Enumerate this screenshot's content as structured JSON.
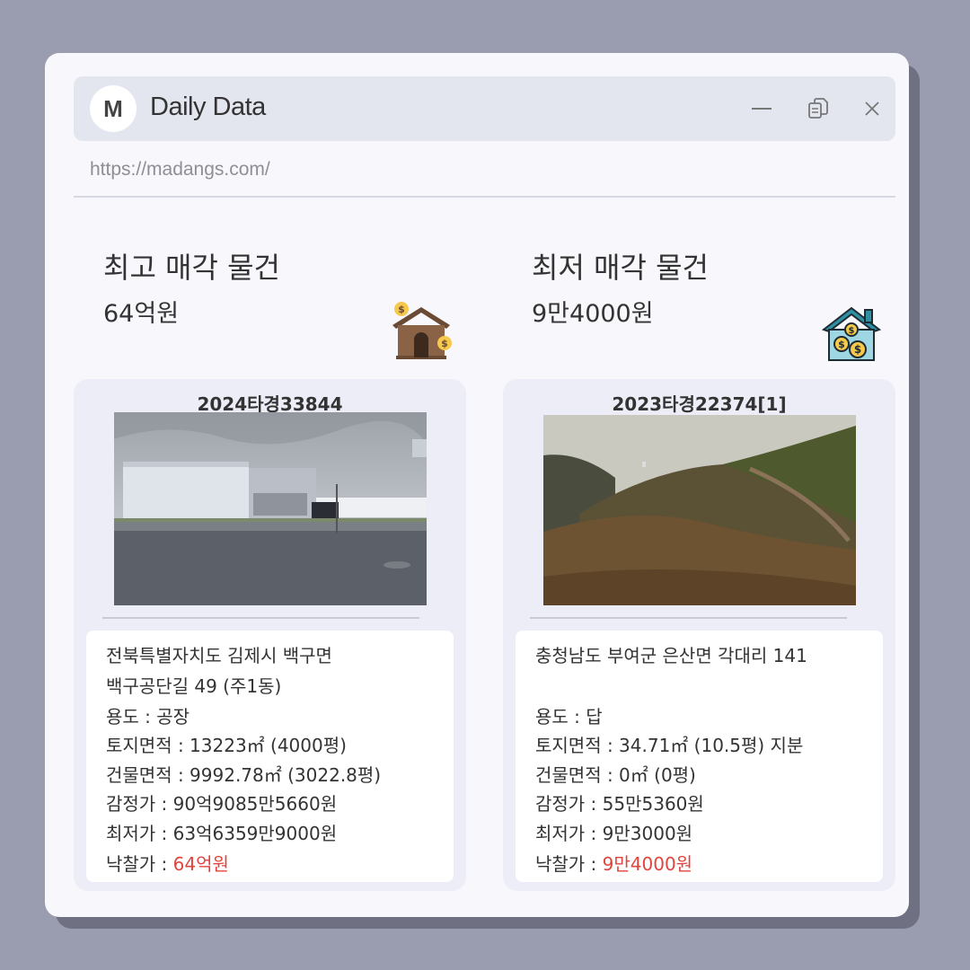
{
  "window": {
    "avatar_letter": "M",
    "title": "Daily Data",
    "url": "https://madangs.com/",
    "controls": [
      "minimize-icon",
      "copy-icon",
      "close-icon"
    ]
  },
  "highest": {
    "heading": "최고 매각 물건",
    "price": "64억원",
    "icon": "house-money-icon",
    "case_no": "2024타경33844",
    "photo": "factory-building-photo",
    "address_line1": "전북특별자치도 김제시 백구면",
    "address_line2": "백구공단길 49 (주1동)",
    "usage": "용도 : 공장",
    "land_area": "토지면적 : 13223㎡ (4000평)",
    "building_area": "건물면적 : 9992.78㎡ (3022.8평)",
    "appraisal": "감정가 : 90억9085만5660원",
    "minimum": "최저가 : 63억6359만9000원",
    "winning_label": "낙찰가 : ",
    "winning_value": "64억원"
  },
  "lowest": {
    "heading": "최저 매각 물건",
    "price": "9만4000원",
    "icon": "house-coins-icon",
    "case_no": "2023타경22374[1]",
    "photo": "dirt-hill-photo",
    "address_line1": "충청남도 부여군 은산면 각대리 141",
    "usage": "용도 : 답",
    "land_area": "토지면적 :  34.71㎡ (10.5평) 지분",
    "building_area": "건물면적 : 0㎡ (0평)",
    "appraisal": "감정가 : 55만5360원",
    "minimum": "최저가 : 9만3000원",
    "winning_label": "낙찰가 : ",
    "winning_value": "9만4000원"
  },
  "colors": {
    "background": "#9a9caf",
    "window": "#f7f7fc",
    "titlebar": "#e4e6ef",
    "card": "#ecedf7",
    "accent_red": "#e0443e"
  }
}
